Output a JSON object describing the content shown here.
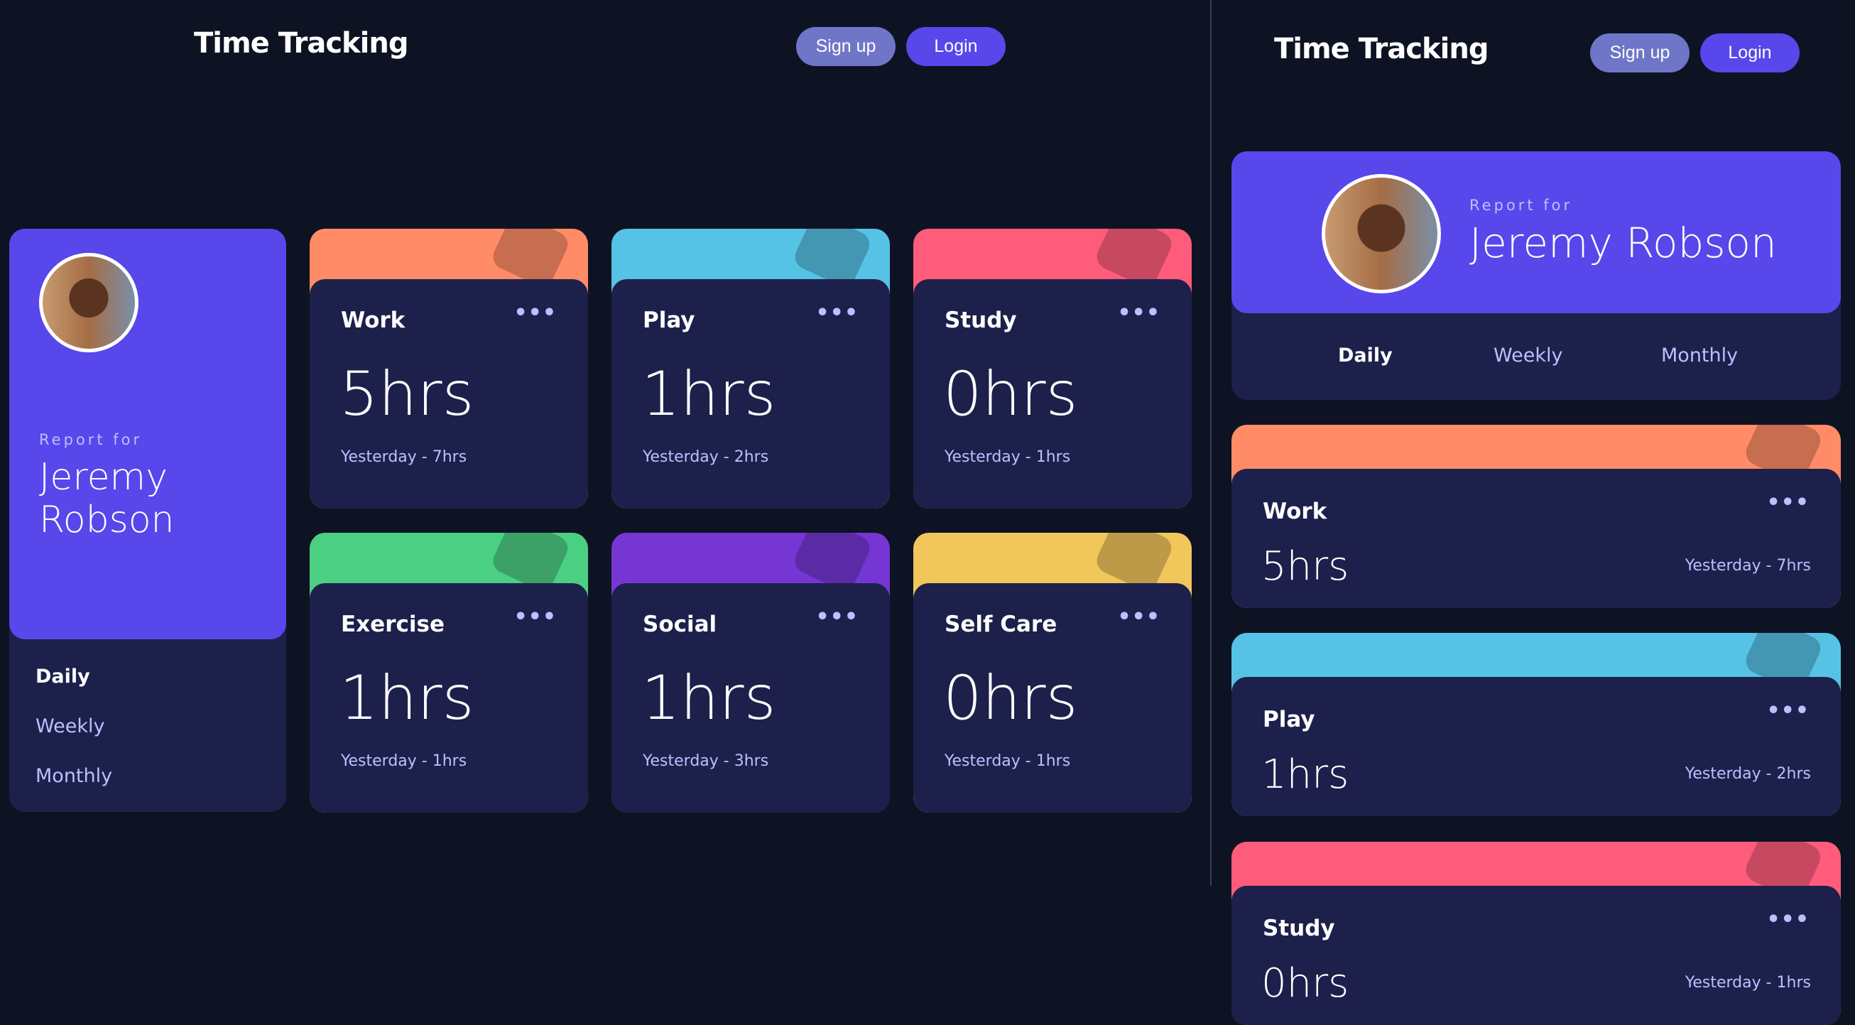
{
  "header": {
    "title": "Time Tracking",
    "signup_label": "Sign up",
    "login_label": "Login"
  },
  "profile": {
    "report_for": "Report for",
    "name_first": "Jeremy",
    "name_last": "Robson",
    "name_full": "Jeremy Robson"
  },
  "tabs": [
    {
      "label": "Daily",
      "active": true
    },
    {
      "label": "Weekly",
      "active": false
    },
    {
      "label": "Monthly",
      "active": false
    }
  ],
  "colors": {
    "background": "#0e1323",
    "card": "#1c204b",
    "accent": "#5847eb",
    "muted": "#bbc0ff",
    "signup": "#6f76c8"
  },
  "activities": [
    {
      "title": "Work",
      "current": "5hrs",
      "previous": "Yesterday - 7hrs",
      "color": "#ff8c66",
      "icon": "briefcase-icon"
    },
    {
      "title": "Play",
      "current": "1hrs",
      "previous": "Yesterday - 2hrs",
      "color": "#56c2e6",
      "icon": "gamepad-icon"
    },
    {
      "title": "Study",
      "current": "0hrs",
      "previous": "Yesterday - 1hrs",
      "color": "#ff5c7c",
      "icon": "book-icon"
    },
    {
      "title": "Exercise",
      "current": "1hrs",
      "previous": "Yesterday - 1hrs",
      "color": "#4bcf83",
      "icon": "running-icon"
    },
    {
      "title": "Social",
      "current": "1hrs",
      "previous": "Yesterday - 3hrs",
      "color": "#7536d3",
      "icon": "social-icon"
    },
    {
      "title": "Self Care",
      "current": "0hrs",
      "previous": "Yesterday - 1hrs",
      "color": "#f1c65b",
      "icon": "self-care-icon"
    }
  ],
  "more_label": "•••"
}
